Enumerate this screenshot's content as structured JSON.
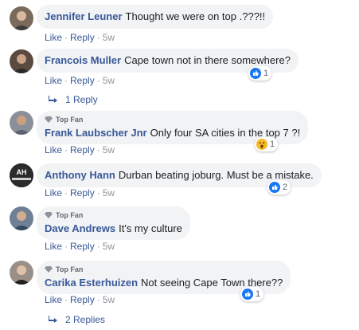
{
  "actions": {
    "like": "Like",
    "reply": "Reply",
    "sep": "·"
  },
  "comments": [
    {
      "name": "Jennifer Leuner",
      "text": "Thought we were on top .???!!",
      "time": "5w"
    },
    {
      "name": "Francois Muller",
      "text": "Cape town not in there somewhere?",
      "time": "5w",
      "reaction": {
        "icon": "like-icon",
        "count": "1"
      },
      "replies": "1 Reply"
    },
    {
      "badge": "Top Fan",
      "name": "Frank Laubscher Jnr",
      "text": "Only four SA cities in the top 7 ?!",
      "time": "5w",
      "reaction": {
        "icon": "wow-icon",
        "count": "1"
      }
    },
    {
      "avatar_text": "AH",
      "name": "Anthony Hann",
      "text": "Durban beating joburg. Must be a mistake.",
      "time": "5w",
      "reaction": {
        "icon": "like-icon",
        "count": "2"
      }
    },
    {
      "badge": "Top Fan",
      "name": "Dave Andrews",
      "text": "It's my culture",
      "time": "5w"
    },
    {
      "badge": "Top Fan",
      "name": "Carika Esterhuizen",
      "text": "Not seeing Cape Town there??",
      "time": "5w",
      "reaction": {
        "icon": "like-icon",
        "count": "1"
      },
      "replies": "2 Replies"
    }
  ],
  "colors": {
    "link": "#385898",
    "bubble": "#f2f3f5",
    "like": "#1877f2",
    "wow": "#f7b928"
  }
}
